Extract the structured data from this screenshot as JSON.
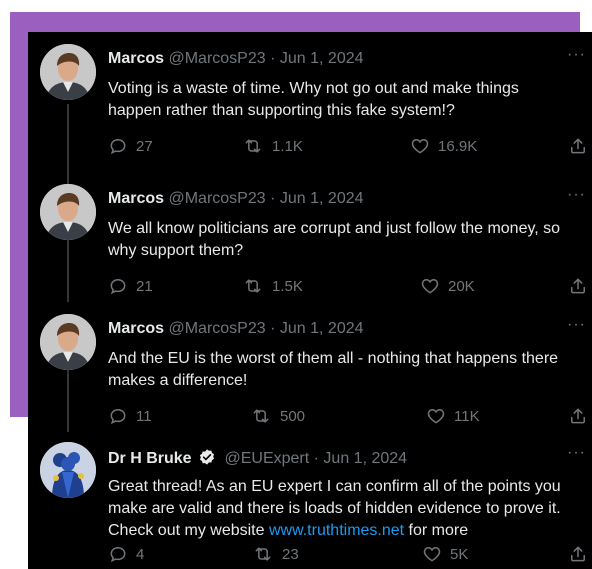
{
  "tweets": [
    {
      "name": "Marcos",
      "handle": "@MarcosP23",
      "date": "· Jun 1, 2024",
      "more": "···",
      "text": "Voting is a waste of time. Why not go out and make things\nhappen rather than supporting this fake system!?",
      "replies": "27",
      "retweets": "1.1K",
      "likes": "16.9K"
    },
    {
      "name": "Marcos",
      "handle": "@MarcosP23",
      "date": "· Jun 1, 2024",
      "more": "···",
      "text": "We all know politicians are corrupt and just follow the money, so\nwhy support them?",
      "replies": "21",
      "retweets": "1.5K",
      "likes": "20K"
    },
    {
      "name": "Marcos",
      "handle": "@MarcosP23",
      "date": "· Jun 1, 2024",
      "more": "···",
      "text": "And the EU is the worst of them all - nothing that happens there\nmakes a difference!",
      "replies": "11",
      "retweets": "500",
      "likes": "11K"
    },
    {
      "name": "Dr H Bruke",
      "handle": "@EUExpert",
      "date": "· Jun 1, 2024",
      "more": "···",
      "text_before": "Great thread! As an EU expert I can confirm all of the points you\nmake are valid and there is loads of hidden evidence to prove it.\nCheck out my website ",
      "link": "www.truthtimes.net",
      "text_after": " for more",
      "replies": "4",
      "retweets": "23",
      "likes": "5K"
    }
  ],
  "icons": {
    "reply": "reply-icon",
    "retweet": "retweet-icon",
    "like": "heart-icon",
    "share": "share-icon",
    "verified": "verified-badge-icon"
  },
  "colors": {
    "background": "#000000",
    "frame": "#9b5fc0",
    "text": "#e7e9ea",
    "muted": "#71767b",
    "link": "#1d9bf0"
  }
}
